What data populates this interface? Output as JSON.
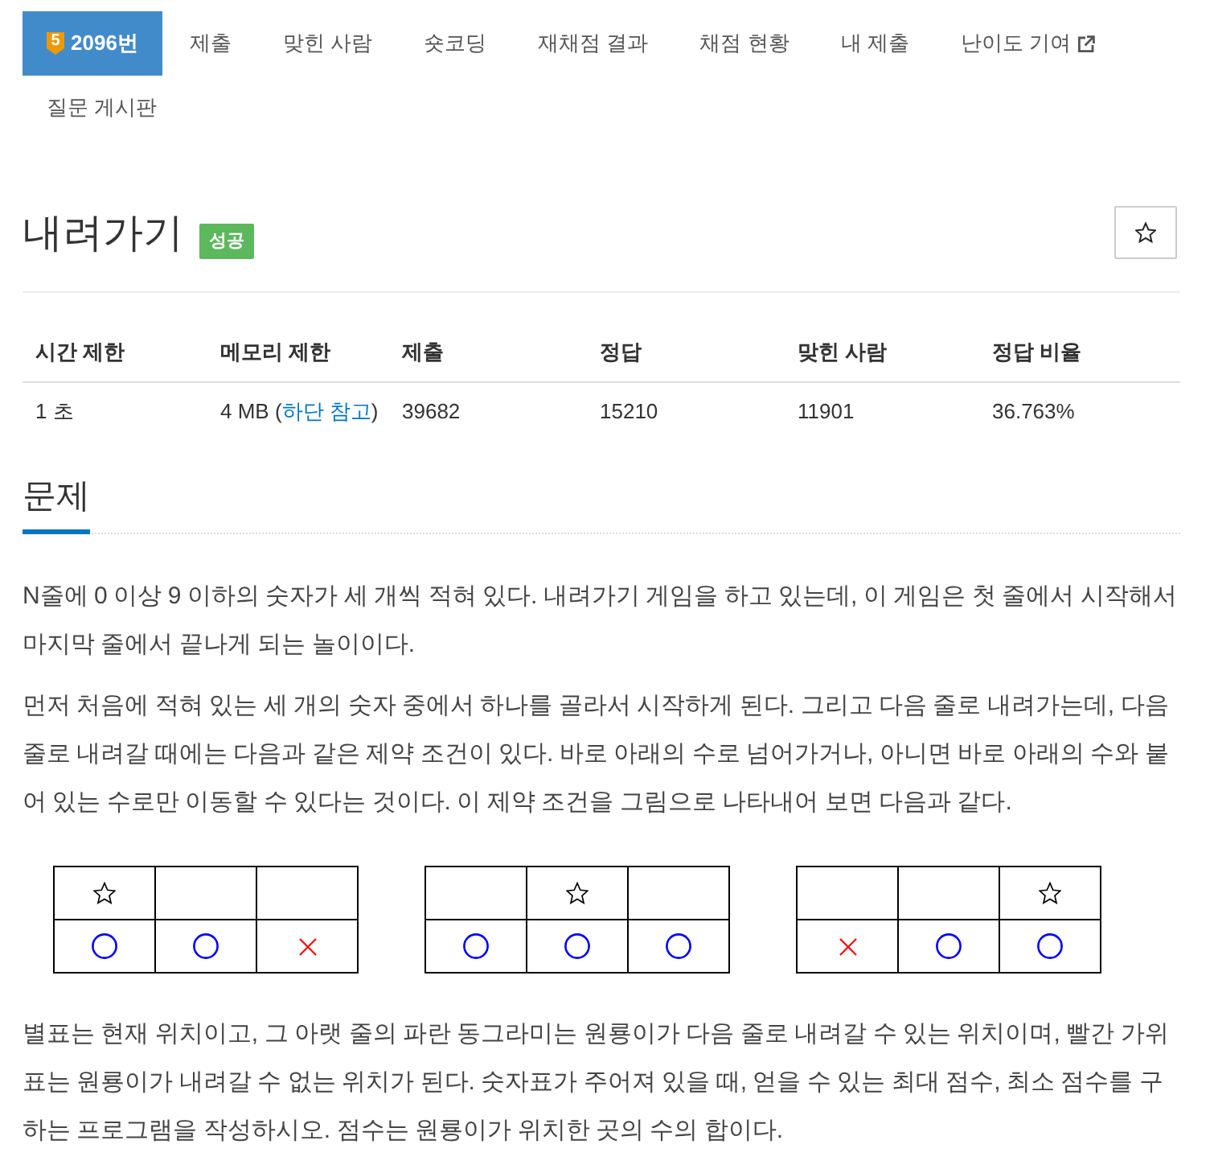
{
  "nav": {
    "tabs": [
      {
        "label": "2096번",
        "tier": "5",
        "external": false,
        "selected": true
      },
      {
        "label": "제출",
        "external": false,
        "selected": false
      },
      {
        "label": "맞힌 사람",
        "external": false,
        "selected": false
      },
      {
        "label": "숏코딩",
        "external": false,
        "selected": false
      },
      {
        "label": "재채점 결과",
        "external": false,
        "selected": false
      },
      {
        "label": "채점 현황",
        "external": false,
        "selected": false
      },
      {
        "label": "내 제출",
        "external": false,
        "selected": false
      },
      {
        "label": "난이도 기여",
        "external": true,
        "selected": false
      },
      {
        "label": "질문 게시판",
        "external": false,
        "selected": false
      }
    ]
  },
  "problem_header": {
    "title": "내려가기",
    "result": "성공"
  },
  "info_table": {
    "columns": [
      "시간 제한",
      "메모리 제한",
      "제출",
      "정답",
      "맞힌 사람",
      "정답 비율"
    ],
    "rows": [
      [
        {
          "text": "1 초"
        },
        {
          "text": "4 MB (",
          "link": "하단 참고",
          "after": ")"
        },
        {
          "text": "39682"
        },
        {
          "text": "15210"
        },
        {
          "text": "11901"
        },
        {
          "text": "36.763%"
        }
      ]
    ]
  },
  "problem": {
    "heading": "문제",
    "body": [
      {
        "kind": "paragraph",
        "text": "N줄에 0 이상 9 이하의 숫자가 세 개씩 적혀 있다. 내려가기 게임을 하고 있는데, 이 게임은 첫 줄에서 시작해서 마지막 줄에서 끝나게 되는 놀이이다."
      },
      {
        "kind": "paragraph",
        "text": "먼저 처음에 적혀 있는 세 개의 숫자 중에서 하나를 골라서 시작하게 된다. 그리고 다음 줄로 내려가는데, 다음 줄로 내려갈 때에는 다음과 같은 제약 조건이 있다. 바로 아래의 수로 넘어가거나, 아니면 바로 아래의 수와 붙어 있는 수로만 이동할 수 있다는 것이다. 이 제약 조건을 그림으로 나타내어 보면 다음과 같다."
      },
      {
        "kind": "figures",
        "grids": [
          {
            "rows": [
              [
                {
                  "kind": "star"
                },
                {
                  "kind": "empty"
                },
                {
                  "kind": "empty"
                }
              ],
              [
                {
                  "kind": "circle"
                },
                {
                  "kind": "circle"
                },
                {
                  "kind": "cross"
                }
              ]
            ]
          },
          {
            "rows": [
              [
                {
                  "kind": "empty"
                },
                {
                  "kind": "star"
                },
                {
                  "kind": "empty"
                }
              ],
              [
                {
                  "kind": "circle"
                },
                {
                  "kind": "circle"
                },
                {
                  "kind": "circle"
                }
              ]
            ]
          },
          {
            "rows": [
              [
                {
                  "kind": "empty"
                },
                {
                  "kind": "empty"
                },
                {
                  "kind": "star"
                }
              ],
              [
                {
                  "kind": "cross"
                },
                {
                  "kind": "circle"
                },
                {
                  "kind": "circle"
                }
              ]
            ]
          }
        ]
      },
      {
        "kind": "paragraph",
        "text": "별표는 현재 위치이고, 그 아랫 줄의 파란 동그라미는 원룡이가 다음 줄로 내려갈 수 있는 위치이며, 빨간 가위표는 원룡이가 내려갈 수 없는 위치가 된다. 숫자표가 주어져 있을 때, 얻을 수 있는 최대 점수, 최소 점수를 구하는 프로그램을 작성하시오. 점수는 원룡이가 위치한 곳의 수의 합이다."
      }
    ]
  }
}
